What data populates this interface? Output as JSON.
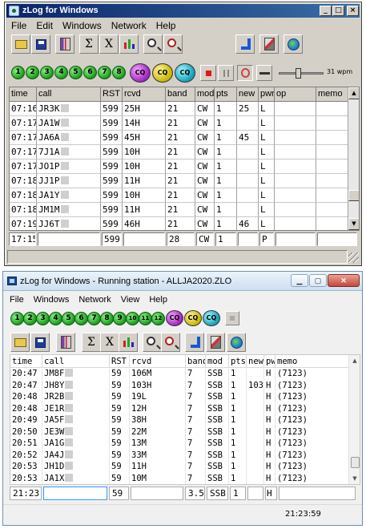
{
  "window1": {
    "title": "zLog for Windows",
    "controls": {
      "minimize": "_",
      "maximize": "□",
      "close": "×"
    },
    "menu": [
      "File",
      "Edit",
      "Windows",
      "Network",
      "Help"
    ],
    "toolbar": {
      "sigma": "Σ",
      "x": "X"
    },
    "bands": [
      "1",
      "2",
      "3",
      "4",
      "5",
      "6",
      "7",
      "8"
    ],
    "cq_buttons": [
      "CQ",
      "CQ",
      "CQ"
    ],
    "cw_speed": "31 wpm",
    "columns": [
      "time",
      "call",
      "RST",
      "rcvd",
      "band",
      "mod",
      "pts",
      "new",
      "pwr",
      "op",
      "memo"
    ],
    "rows": [
      {
        "time": "07:16",
        "call": "JR3K",
        "rst": "599",
        "rcvd": "25H",
        "band": "21",
        "mod": "CW",
        "pts": "1",
        "new": "25",
        "pwr": "L",
        "op": "",
        "memo": ""
      },
      {
        "time": "07:17",
        "call": "JA1W",
        "rst": "599",
        "rcvd": "14H",
        "band": "21",
        "mod": "CW",
        "pts": "1",
        "new": "",
        "pwr": "L",
        "op": "",
        "memo": ""
      },
      {
        "time": "07:17",
        "call": "JA6A",
        "rst": "599",
        "rcvd": "45H",
        "band": "21",
        "mod": "CW",
        "pts": "1",
        "new": "45",
        "pwr": "L",
        "op": "",
        "memo": ""
      },
      {
        "time": "07:17",
        "call": "7J1A",
        "rst": "599",
        "rcvd": "10H",
        "band": "21",
        "mod": "CW",
        "pts": "1",
        "new": "",
        "pwr": "L",
        "op": "",
        "memo": ""
      },
      {
        "time": "07:17",
        "call": "JO1P",
        "rst": "599",
        "rcvd": "10H",
        "band": "21",
        "mod": "CW",
        "pts": "1",
        "new": "",
        "pwr": "L",
        "op": "",
        "memo": ""
      },
      {
        "time": "07:18",
        "call": "JJ1P",
        "rst": "599",
        "rcvd": "11H",
        "band": "21",
        "mod": "CW",
        "pts": "1",
        "new": "",
        "pwr": "L",
        "op": "",
        "memo": ""
      },
      {
        "time": "07:18",
        "call": "JA1Y",
        "rst": "599",
        "rcvd": "10H",
        "band": "21",
        "mod": "CW",
        "pts": "1",
        "new": "",
        "pwr": "L",
        "op": "",
        "memo": ""
      },
      {
        "time": "07:18",
        "call": "JM1M",
        "rst": "599",
        "rcvd": "11H",
        "band": "21",
        "mod": "CW",
        "pts": "1",
        "new": "",
        "pwr": "L",
        "op": "",
        "memo": ""
      },
      {
        "time": "07:19",
        "call": "JJ6T",
        "rst": "599",
        "rcvd": "46H",
        "band": "21",
        "mod": "CW",
        "pts": "1",
        "new": "46",
        "pwr": "L",
        "op": "",
        "memo": ""
      }
    ],
    "entry": {
      "time": "17:15",
      "call": "",
      "rst": "599",
      "rcvd": "",
      "band": "28",
      "mod": "CW",
      "pts": "1",
      "new": "",
      "pwr": "P",
      "op": "",
      "memo": ""
    }
  },
  "window2": {
    "title": "zLog for Windows - Running station - ALLJA2020.ZLO",
    "menu": [
      "File",
      "Windows",
      "Network",
      "View",
      "Help"
    ],
    "toolbar": {
      "sigma": "Σ",
      "x": "X"
    },
    "bands": [
      "1",
      "2",
      "3",
      "4",
      "5",
      "6",
      "7",
      "8",
      "9",
      "10",
      "11",
      "12"
    ],
    "cq_buttons": [
      "CQ",
      "CQ",
      "CQ"
    ],
    "columns": [
      "time",
      "call",
      "RST",
      "rcvd",
      "band",
      "mod",
      "pts",
      "new",
      "pw",
      "memo"
    ],
    "rows": [
      {
        "time": "20:47",
        "call": "JM8F",
        "rst": "59",
        "rcvd": "106M",
        "band": "7",
        "mod": "SSB",
        "pts": "1",
        "new": "",
        "pw": "H",
        "memo": "(7123)"
      },
      {
        "time": "20:47",
        "call": "JH8Y",
        "rst": "59",
        "rcvd": "103H",
        "band": "7",
        "mod": "SSB",
        "pts": "1",
        "new": "103",
        "pw": "H",
        "memo": "(7123)"
      },
      {
        "time": "20:48",
        "call": "JR2B",
        "rst": "59",
        "rcvd": "19L",
        "band": "7",
        "mod": "SSB",
        "pts": "1",
        "new": "",
        "pw": "H",
        "memo": "(7123)"
      },
      {
        "time": "20:48",
        "call": "JE1R",
        "rst": "59",
        "rcvd": "12H",
        "band": "7",
        "mod": "SSB",
        "pts": "1",
        "new": "",
        "pw": "H",
        "memo": "(7123)"
      },
      {
        "time": "20:49",
        "call": "JA5F",
        "rst": "59",
        "rcvd": "38H",
        "band": "7",
        "mod": "SSB",
        "pts": "1",
        "new": "",
        "pw": "H",
        "memo": "(7123)"
      },
      {
        "time": "20:50",
        "call": "JE3W",
        "rst": "59",
        "rcvd": "22M",
        "band": "7",
        "mod": "SSB",
        "pts": "1",
        "new": "",
        "pw": "H",
        "memo": "(7123)"
      },
      {
        "time": "20:51",
        "call": "JA1G",
        "rst": "59",
        "rcvd": "13M",
        "band": "7",
        "mod": "SSB",
        "pts": "1",
        "new": "",
        "pw": "H",
        "memo": "(7123)"
      },
      {
        "time": "20:52",
        "call": "JA4J",
        "rst": "59",
        "rcvd": "33M",
        "band": "7",
        "mod": "SSB",
        "pts": "1",
        "new": "",
        "pw": "H",
        "memo": "(7123)"
      },
      {
        "time": "20:53",
        "call": "JH1D",
        "rst": "59",
        "rcvd": "11H",
        "band": "7",
        "mod": "SSB",
        "pts": "1",
        "new": "",
        "pw": "H",
        "memo": "(7123)"
      },
      {
        "time": "20:53",
        "call": "JA1X",
        "rst": "59",
        "rcvd": "10M",
        "band": "7",
        "mod": "SSB",
        "pts": "1",
        "new": "",
        "pw": "H",
        "memo": "(7123)"
      }
    ],
    "entry": {
      "time": "21:23",
      "call": "",
      "rst": "59",
      "rcvd": "",
      "band": "3.5",
      "mod": "SSB",
      "pts": "1",
      "new": "",
      "pw": "H",
      "memo": ""
    },
    "status_clock": "21:23:59"
  }
}
